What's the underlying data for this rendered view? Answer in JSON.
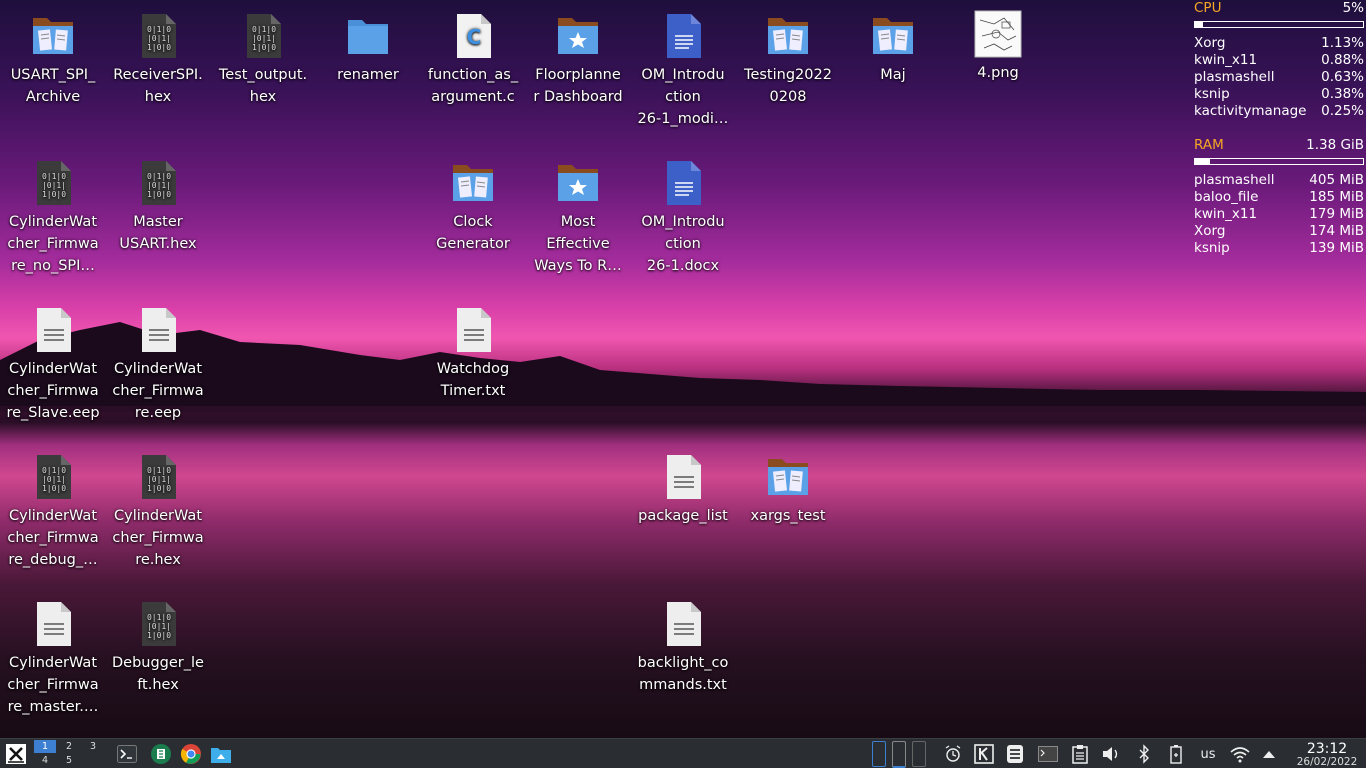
{
  "desktop": {
    "icons": [
      {
        "label": "USART_SPI_\nArchive",
        "icon": "folder-documents-icon"
      },
      {
        "label": "ReceiverSPI.\nhex",
        "icon": "binary-file-icon"
      },
      {
        "label": "Test_output.\nhex",
        "icon": "binary-file-icon"
      },
      {
        "label": "renamer",
        "icon": "folder-icon"
      },
      {
        "label": "function_as_\nargument.c",
        "icon": "c-source-file-icon"
      },
      {
        "label": "Floorplanne\nr Dashboard",
        "icon": "folder-favorites-icon"
      },
      {
        "label": "OM_Introdu\nction\n26-1_modi…",
        "icon": "document-icon"
      },
      {
        "label": "Testing2022\n0208",
        "icon": "folder-documents-icon"
      },
      {
        "label": "Maj",
        "icon": "folder-documents-icon"
      },
      {
        "label": "4.png",
        "icon": "image-thumbnail-icon"
      },
      {
        "label": "CylinderWat\ncher_Firmwa\nre_no_SPI…",
        "icon": "binary-file-icon"
      },
      {
        "label": "Master\nUSART.hex",
        "icon": "binary-file-icon"
      },
      {
        "label": "Clock\nGenerator",
        "icon": "folder-documents-icon"
      },
      {
        "label": "Most\nEffective\nWays To R…",
        "icon": "folder-favorites-icon"
      },
      {
        "label": "OM_Introdu\nction\n26-1.docx",
        "icon": "document-icon"
      },
      {
        "label": "CylinderWat\ncher_Firmwa\nre_Slave.eep",
        "icon": "text-file-icon"
      },
      {
        "label": "CylinderWat\ncher_Firmwa\nre.eep",
        "icon": "text-file-icon"
      },
      {
        "label": "Watchdog\nTimer.txt",
        "icon": "text-file-icon"
      },
      {
        "label": "CylinderWat\ncher_Firmwa\nre_debug_…",
        "icon": "binary-file-icon"
      },
      {
        "label": "CylinderWat\ncher_Firmwa\nre.hex",
        "icon": "binary-file-icon"
      },
      {
        "label": "package_list",
        "icon": "text-file-icon"
      },
      {
        "label": "xargs_test",
        "icon": "folder-documents-icon"
      },
      {
        "label": "CylinderWat\ncher_Firmwa\nre_master.…",
        "icon": "text-file-icon"
      },
      {
        "label": "Debugger_le\nft.hex",
        "icon": "binary-file-icon"
      },
      {
        "label": "backlight_co\nmmands.txt",
        "icon": "text-file-icon"
      }
    ]
  },
  "sysmon": {
    "cpu": {
      "label": "CPU",
      "value": "5%",
      "fraction": 0.05,
      "processes": [
        {
          "name": "Xorg",
          "value": "1.13%"
        },
        {
          "name": "kwin_x11",
          "value": "0.88%"
        },
        {
          "name": "plasmashell",
          "value": "0.63%"
        },
        {
          "name": "ksnip",
          "value": "0.38%"
        },
        {
          "name": "kactivitymanage",
          "value": "0.25%"
        }
      ]
    },
    "ram": {
      "label": "RAM",
      "value": "1.38 GiB",
      "fraction": 0.09,
      "processes": [
        {
          "name": "plasmashell",
          "value": "405 MiB"
        },
        {
          "name": "baloo_file",
          "value": "185 MiB"
        },
        {
          "name": "kwin_x11",
          "value": "179 MiB"
        },
        {
          "name": "Xorg",
          "value": "174 MiB"
        },
        {
          "name": "ksnip",
          "value": "139 MiB"
        }
      ]
    }
  },
  "taskbar": {
    "pager": [
      "1",
      "2",
      "3",
      "4",
      "5"
    ],
    "active_desktop": "1",
    "keyboard_layout": "us",
    "time": "23:12",
    "date": "26/02/2022",
    "accent": "#3d7fd1"
  }
}
